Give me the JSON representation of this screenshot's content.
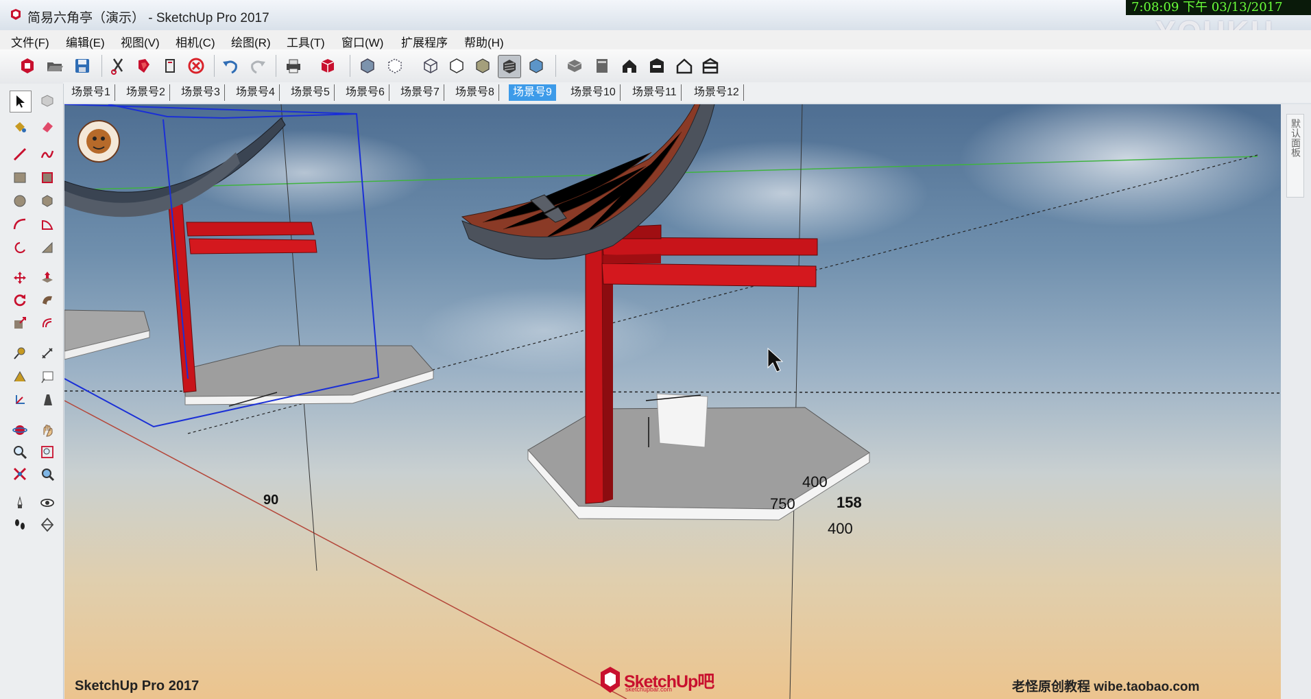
{
  "window": {
    "title": "简易六角亭（演示） - SketchUp Pro 2017",
    "clock": "7:08:09 下午 03/13/2017",
    "watermark": "YOUKU"
  },
  "menu": [
    "文件(F)",
    "编辑(E)",
    "视图(V)",
    "相机(C)",
    "绘图(R)",
    "工具(T)",
    "窗口(W)",
    "扩展程序",
    "帮助(H)"
  ],
  "toolbar": {
    "buttons": [
      "model-info-icon",
      "open-icon",
      "save-icon",
      "cut-icon",
      "paint-icon",
      "copy-icon",
      "erase-icon",
      "undo-icon",
      "redo-icon",
      "print-icon",
      "components-icon",
      "xray-icon",
      "back-edges-icon",
      "wireframe-icon",
      "hidden-line-icon",
      "shaded-icon",
      "shaded-textures-icon",
      "monochrome-icon",
      "iso-view-icon",
      "top-view-icon",
      "front-view-icon",
      "right-view-icon",
      "back-view-icon",
      "left-view-icon"
    ]
  },
  "scenes": {
    "tabs": [
      "场景号1",
      "场景号2",
      "场景号3",
      "场景号4",
      "场景号5",
      "场景号6",
      "场景号7",
      "场景号8",
      "场景号9",
      "场景号10",
      "场景号11",
      "场景号12"
    ],
    "active_index": 8
  },
  "tools": {
    "buttons": [
      "select-icon",
      "component-icon",
      "paint-bucket-icon",
      "eraser-icon",
      "line-icon",
      "freehand-icon",
      "rectangle-icon",
      "rotated-rectangle-icon",
      "circle-icon",
      "polygon-icon",
      "arc-icon",
      "pie-icon",
      "rotate-arc-icon",
      "arc-3pt-icon",
      "move-icon",
      "push-pull-icon",
      "rotate-icon",
      "follow-me-icon",
      "scale-icon",
      "offset-icon",
      "tape-measure-icon",
      "dimension-icon",
      "protractor-icon",
      "text-icon",
      "axes-icon",
      "3d-text-icon",
      "orbit-icon",
      "pan-icon",
      "zoom-icon",
      "zoom-window-icon",
      "zoom-extents-icon",
      "prev-view-icon",
      "position-camera-icon",
      "look-around-icon",
      "walk-icon",
      "section-plane-icon"
    ]
  },
  "viewport": {
    "product_label": "SketchUp Pro 2017",
    "brand_watermark": "老怪原创教程   wibe.taobao.com",
    "logo_text": "SketchUp吧",
    "logo_sub": "sketchupbar.com",
    "dimensions": {
      "d1": "400",
      "d2": "750",
      "d3": "158",
      "d4": "400",
      "d5": "90"
    }
  },
  "tray": {
    "label": "默认面板"
  },
  "colors": {
    "pillar_red": "#c8141a",
    "roof_tiles": "#8a3a26",
    "selection_blue": "#1a2fd6",
    "active_tab": "#3d9be9"
  }
}
